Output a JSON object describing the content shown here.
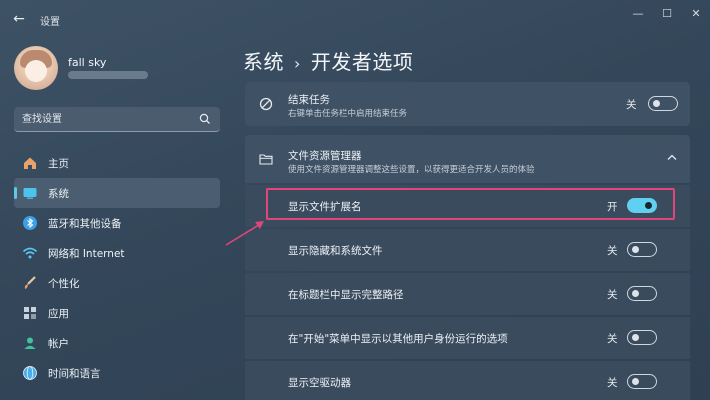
{
  "window": {
    "title": "设置",
    "back_glyph": "←",
    "minimize_glyph": "—",
    "maximize_glyph": "☐",
    "close_glyph": "✕"
  },
  "user": {
    "name": "fall sky"
  },
  "search": {
    "placeholder": "查找设置"
  },
  "sidebar": {
    "items": [
      {
        "label": "主页",
        "icon": "home-icon"
      },
      {
        "label": "系统",
        "icon": "system-icon",
        "active": true
      },
      {
        "label": "蓝牙和其他设备",
        "icon": "bluetooth-icon"
      },
      {
        "label": "网络和 Internet",
        "icon": "wifi-icon"
      },
      {
        "label": "个性化",
        "icon": "brush-icon"
      },
      {
        "label": "应用",
        "icon": "apps-icon"
      },
      {
        "label": "帐户",
        "icon": "account-icon"
      },
      {
        "label": "时间和语言",
        "icon": "globe-icon"
      }
    ]
  },
  "breadcrumb": {
    "parent": "系统",
    "separator": "›",
    "current": "开发者选项"
  },
  "settings": {
    "end_task": {
      "title": "结束任务",
      "description": "右键单击任务栏中启用结束任务",
      "state_label": "关",
      "on": false
    },
    "file_explorer": {
      "title": "文件资源管理器",
      "description": "使用文件资源管理器调整这些设置，以获得更适合开发人员的体验",
      "expanded": true,
      "items": [
        {
          "title": "显示文件扩展名",
          "state_label": "开",
          "on": true
        },
        {
          "title": "显示隐藏和系统文件",
          "state_label": "关",
          "on": false
        },
        {
          "title": "在标题栏中显示完整路径",
          "state_label": "关",
          "on": false
        },
        {
          "title": "在\"开始\"菜单中显示以其他用户身份运行的选项",
          "state_label": "关",
          "on": false
        },
        {
          "title": "显示空驱动器",
          "state_label": "关",
          "on": false
        }
      ]
    }
  },
  "colors": {
    "accent": "#5fd0f0",
    "highlight_box": "#e0457c"
  }
}
